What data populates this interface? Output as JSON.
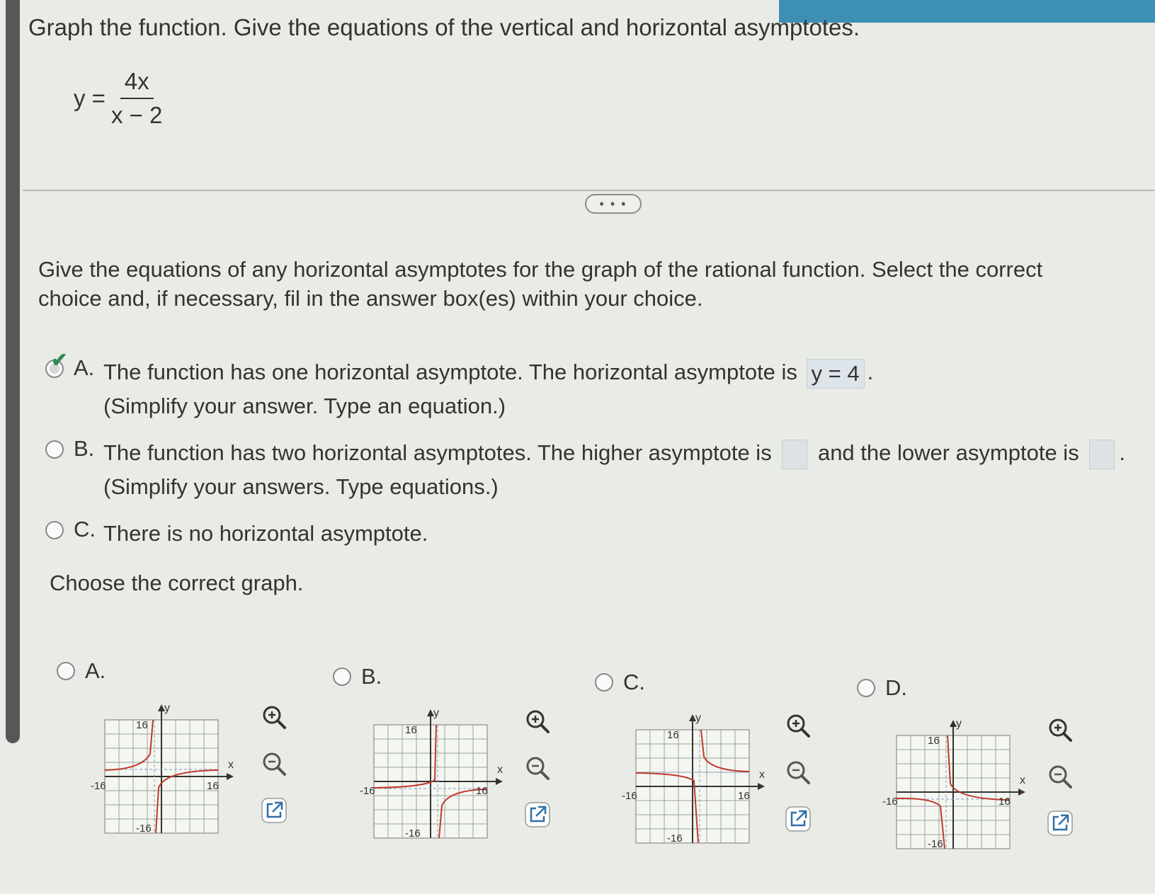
{
  "question": {
    "title": "Graph the function. Give the equations of the vertical and horizontal asymptotes.",
    "equation": {
      "lhs": "y =",
      "numerator": "4x",
      "denominator": "x − 2"
    }
  },
  "more_button": "• • •",
  "part": {
    "prompt": "Give the equations of any horizontal asymptotes for the graph of the rational function. Select the correct choice and, if necessary, fil in the answer box(es) within your choice.",
    "choices": [
      {
        "letter": "A.",
        "line1": "The function has one horizontal asymptote. The horizontal asymptote is",
        "answer": "y = 4",
        "end": ".",
        "line2": "(Simplify your answer. Type an equation.)",
        "selected": true
      },
      {
        "letter": "B.",
        "line1a": "The function has two horizontal asymptotes. The higher asymptote is",
        "line1b": "and the lower asymptote is",
        "end": ".",
        "line2": "(Simplify your answers. Type equations.)",
        "selected": false
      },
      {
        "letter": "C.",
        "line1": "There is no horizontal asymptote.",
        "selected": false
      }
    ]
  },
  "graph_section": {
    "prompt": "Choose the correct graph.",
    "options": [
      {
        "letter": "A.",
        "axis_max": "16",
        "axis_min": "-16",
        "x_label": "x",
        "y_label": "y"
      },
      {
        "letter": "B.",
        "axis_max": "16",
        "axis_min": "-16",
        "x_label": "x",
        "y_label": "y"
      },
      {
        "letter": "C.",
        "axis_max": "16",
        "axis_min": "-16",
        "x_label": "x",
        "y_label": "y"
      },
      {
        "letter": "D.",
        "axis_max": "16",
        "axis_min": "-16",
        "x_label": "x",
        "y_label": "y"
      }
    ]
  },
  "icons": [
    "zoom-in-icon",
    "zoom-out-icon",
    "open-external-icon",
    "checkmark-icon"
  ],
  "colors": {
    "accent": "#3d8fb3",
    "curve": "#c0392b",
    "asymptote": "#8a9cc0",
    "check": "#2e8b57"
  }
}
